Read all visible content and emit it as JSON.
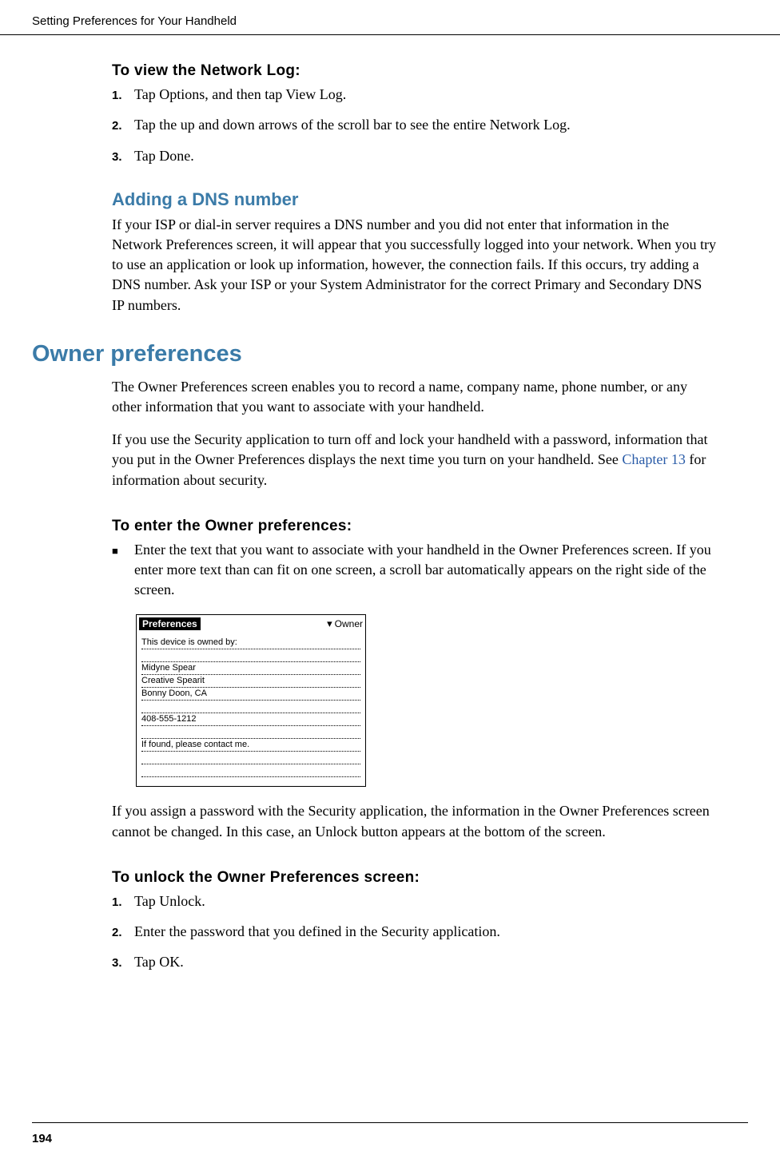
{
  "header": "Setting Preferences for Your Handheld",
  "page_num": "194",
  "section1": {
    "title": "To view the Network Log:",
    "steps": [
      {
        "num": "1.",
        "text": "Tap Options, and then tap View Log."
      },
      {
        "num": "2.",
        "text": "Tap the up and down arrows of the scroll bar to see the entire Network Log."
      },
      {
        "num": "3.",
        "text": "Tap Done."
      }
    ]
  },
  "section2": {
    "title": "Adding a DNS number",
    "body": "If your ISP or dial-in server requires a DNS number and you did not enter that information in the Network Preferences screen, it will appear that you successfully logged into your network. When you try to use an application or look up information, however, the connection fails. If this occurs, try adding a DNS number. Ask your ISP or your System Administrator for the correct Primary and Secondary DNS IP numbers."
  },
  "section3": {
    "title": "Owner preferences",
    "body1": "The Owner Preferences screen enables you to record a name, company name, phone number, or any other information that you want to associate with your handheld.",
    "body2a": "If you use the Security application to turn off and lock your handheld with a password, information that you put in the Owner Preferences displays the next time you turn on your handheld. See ",
    "body2link": "Chapter 13",
    "body2b": " for information about security."
  },
  "section4": {
    "title": "To enter the Owner preferences:",
    "bullet": "Enter the text that you want to associate with your handheld in the Owner Preferences screen. If you enter more text than can fit on one screen, a scroll bar automatically appears on the right side of the screen."
  },
  "screenshot": {
    "title": "Preferences",
    "dropdown": "Owner",
    "lines": [
      "This device  is owned by:",
      "",
      "Midyne Spear",
      "Creative Spearit",
      "Bonny Doon, CA",
      "",
      "408-555-1212",
      "",
      "If found, please contact me.",
      "",
      ""
    ]
  },
  "body_after_screenshot": "If you assign a password with the Security application, the information in the Owner Preferences screen cannot be changed. In this case, an Unlock button appears at the bottom of the screen.",
  "section5": {
    "title": "To unlock the Owner Preferences screen:",
    "steps": [
      {
        "num": "1.",
        "text": "Tap Unlock."
      },
      {
        "num": "2.",
        "text": "Enter the password that you defined in the Security application."
      },
      {
        "num": "3.",
        "text": "Tap OK."
      }
    ]
  }
}
